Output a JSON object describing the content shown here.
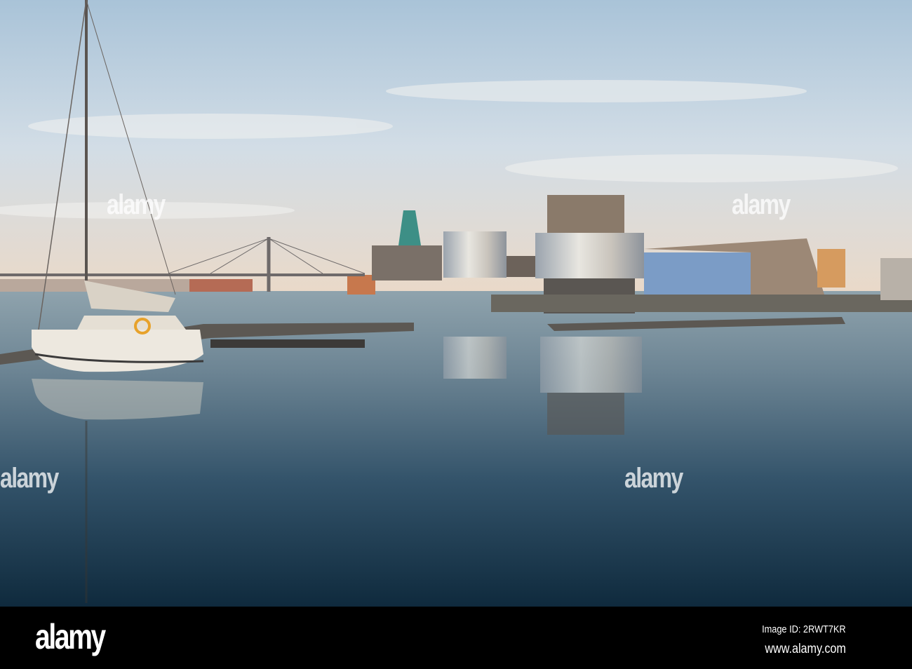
{
  "photo": {
    "subject": "Harbor with sailboat and museum buildings reflected in calm water"
  },
  "watermark": {
    "text": "alamy"
  },
  "footer": {
    "logo": "alamy",
    "image_id": "Image ID: 2RWT7KR",
    "website": "www.alamy.com"
  }
}
